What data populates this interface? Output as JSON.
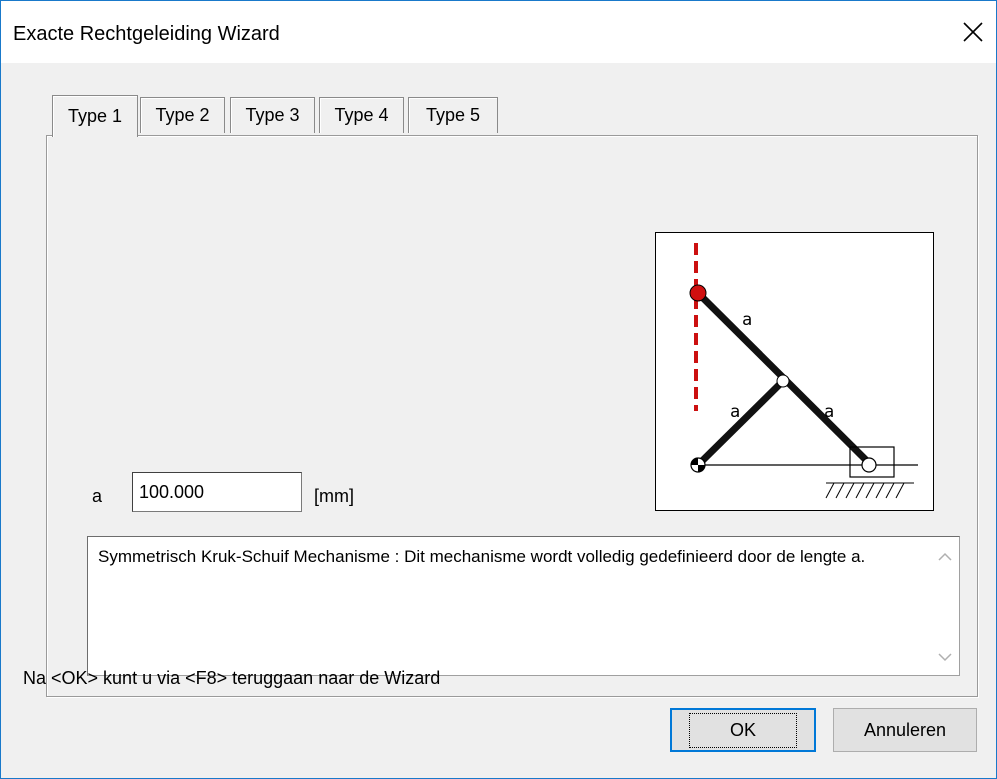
{
  "window": {
    "title": "Exacte Rechtgeleiding Wizard"
  },
  "tabs": [
    {
      "label": "Type 1",
      "active": true
    },
    {
      "label": "Type 2",
      "active": false
    },
    {
      "label": "Type 3",
      "active": false
    },
    {
      "label": "Type 4",
      "active": false
    },
    {
      "label": "Type 5",
      "active": false
    }
  ],
  "diagram": {
    "labels": {
      "top_link": "a",
      "left_link": "a",
      "right_link": "a"
    }
  },
  "parameter": {
    "label": "a",
    "value": "100.000",
    "unit": "[mm]"
  },
  "description": "Symmetrisch Kruk-Schuif Mechanisme : Dit mechanisme wordt volledig gedefinieerd door de lengte a.",
  "footer": {
    "hint": "Na <OK> kunt u via <F8> teruggaan naar de Wizard"
  },
  "buttons": {
    "ok": "OK",
    "cancel": "Annuleren"
  },
  "colors": {
    "accent": "#0078d7",
    "joint_red": "#d01010",
    "guide_red": "#cc1010"
  }
}
